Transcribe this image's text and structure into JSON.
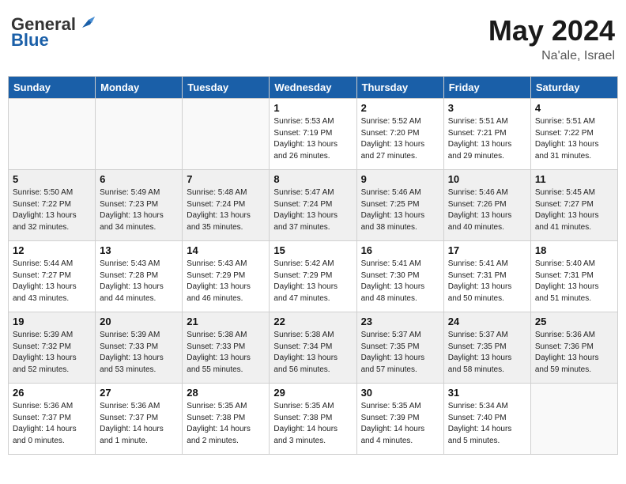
{
  "header": {
    "logo_general": "General",
    "logo_blue": "Blue",
    "month": "May 2024",
    "location": "Na'ale, Israel"
  },
  "days_of_week": [
    "Sunday",
    "Monday",
    "Tuesday",
    "Wednesday",
    "Thursday",
    "Friday",
    "Saturday"
  ],
  "weeks": [
    {
      "shaded": false,
      "days": [
        {
          "num": "",
          "info": ""
        },
        {
          "num": "",
          "info": ""
        },
        {
          "num": "",
          "info": ""
        },
        {
          "num": "1",
          "info": "Sunrise: 5:53 AM\nSunset: 7:19 PM\nDaylight: 13 hours\nand 26 minutes."
        },
        {
          "num": "2",
          "info": "Sunrise: 5:52 AM\nSunset: 7:20 PM\nDaylight: 13 hours\nand 27 minutes."
        },
        {
          "num": "3",
          "info": "Sunrise: 5:51 AM\nSunset: 7:21 PM\nDaylight: 13 hours\nand 29 minutes."
        },
        {
          "num": "4",
          "info": "Sunrise: 5:51 AM\nSunset: 7:22 PM\nDaylight: 13 hours\nand 31 minutes."
        }
      ]
    },
    {
      "shaded": true,
      "days": [
        {
          "num": "5",
          "info": "Sunrise: 5:50 AM\nSunset: 7:22 PM\nDaylight: 13 hours\nand 32 minutes."
        },
        {
          "num": "6",
          "info": "Sunrise: 5:49 AM\nSunset: 7:23 PM\nDaylight: 13 hours\nand 34 minutes."
        },
        {
          "num": "7",
          "info": "Sunrise: 5:48 AM\nSunset: 7:24 PM\nDaylight: 13 hours\nand 35 minutes."
        },
        {
          "num": "8",
          "info": "Sunrise: 5:47 AM\nSunset: 7:24 PM\nDaylight: 13 hours\nand 37 minutes."
        },
        {
          "num": "9",
          "info": "Sunrise: 5:46 AM\nSunset: 7:25 PM\nDaylight: 13 hours\nand 38 minutes."
        },
        {
          "num": "10",
          "info": "Sunrise: 5:46 AM\nSunset: 7:26 PM\nDaylight: 13 hours\nand 40 minutes."
        },
        {
          "num": "11",
          "info": "Sunrise: 5:45 AM\nSunset: 7:27 PM\nDaylight: 13 hours\nand 41 minutes."
        }
      ]
    },
    {
      "shaded": false,
      "days": [
        {
          "num": "12",
          "info": "Sunrise: 5:44 AM\nSunset: 7:27 PM\nDaylight: 13 hours\nand 43 minutes."
        },
        {
          "num": "13",
          "info": "Sunrise: 5:43 AM\nSunset: 7:28 PM\nDaylight: 13 hours\nand 44 minutes."
        },
        {
          "num": "14",
          "info": "Sunrise: 5:43 AM\nSunset: 7:29 PM\nDaylight: 13 hours\nand 46 minutes."
        },
        {
          "num": "15",
          "info": "Sunrise: 5:42 AM\nSunset: 7:29 PM\nDaylight: 13 hours\nand 47 minutes."
        },
        {
          "num": "16",
          "info": "Sunrise: 5:41 AM\nSunset: 7:30 PM\nDaylight: 13 hours\nand 48 minutes."
        },
        {
          "num": "17",
          "info": "Sunrise: 5:41 AM\nSunset: 7:31 PM\nDaylight: 13 hours\nand 50 minutes."
        },
        {
          "num": "18",
          "info": "Sunrise: 5:40 AM\nSunset: 7:31 PM\nDaylight: 13 hours\nand 51 minutes."
        }
      ]
    },
    {
      "shaded": true,
      "days": [
        {
          "num": "19",
          "info": "Sunrise: 5:39 AM\nSunset: 7:32 PM\nDaylight: 13 hours\nand 52 minutes."
        },
        {
          "num": "20",
          "info": "Sunrise: 5:39 AM\nSunset: 7:33 PM\nDaylight: 13 hours\nand 53 minutes."
        },
        {
          "num": "21",
          "info": "Sunrise: 5:38 AM\nSunset: 7:33 PM\nDaylight: 13 hours\nand 55 minutes."
        },
        {
          "num": "22",
          "info": "Sunrise: 5:38 AM\nSunset: 7:34 PM\nDaylight: 13 hours\nand 56 minutes."
        },
        {
          "num": "23",
          "info": "Sunrise: 5:37 AM\nSunset: 7:35 PM\nDaylight: 13 hours\nand 57 minutes."
        },
        {
          "num": "24",
          "info": "Sunrise: 5:37 AM\nSunset: 7:35 PM\nDaylight: 13 hours\nand 58 minutes."
        },
        {
          "num": "25",
          "info": "Sunrise: 5:36 AM\nSunset: 7:36 PM\nDaylight: 13 hours\nand 59 minutes."
        }
      ]
    },
    {
      "shaded": false,
      "days": [
        {
          "num": "26",
          "info": "Sunrise: 5:36 AM\nSunset: 7:37 PM\nDaylight: 14 hours\nand 0 minutes."
        },
        {
          "num": "27",
          "info": "Sunrise: 5:36 AM\nSunset: 7:37 PM\nDaylight: 14 hours\nand 1 minute."
        },
        {
          "num": "28",
          "info": "Sunrise: 5:35 AM\nSunset: 7:38 PM\nDaylight: 14 hours\nand 2 minutes."
        },
        {
          "num": "29",
          "info": "Sunrise: 5:35 AM\nSunset: 7:38 PM\nDaylight: 14 hours\nand 3 minutes."
        },
        {
          "num": "30",
          "info": "Sunrise: 5:35 AM\nSunset: 7:39 PM\nDaylight: 14 hours\nand 4 minutes."
        },
        {
          "num": "31",
          "info": "Sunrise: 5:34 AM\nSunset: 7:40 PM\nDaylight: 14 hours\nand 5 minutes."
        },
        {
          "num": "",
          "info": ""
        }
      ]
    }
  ]
}
